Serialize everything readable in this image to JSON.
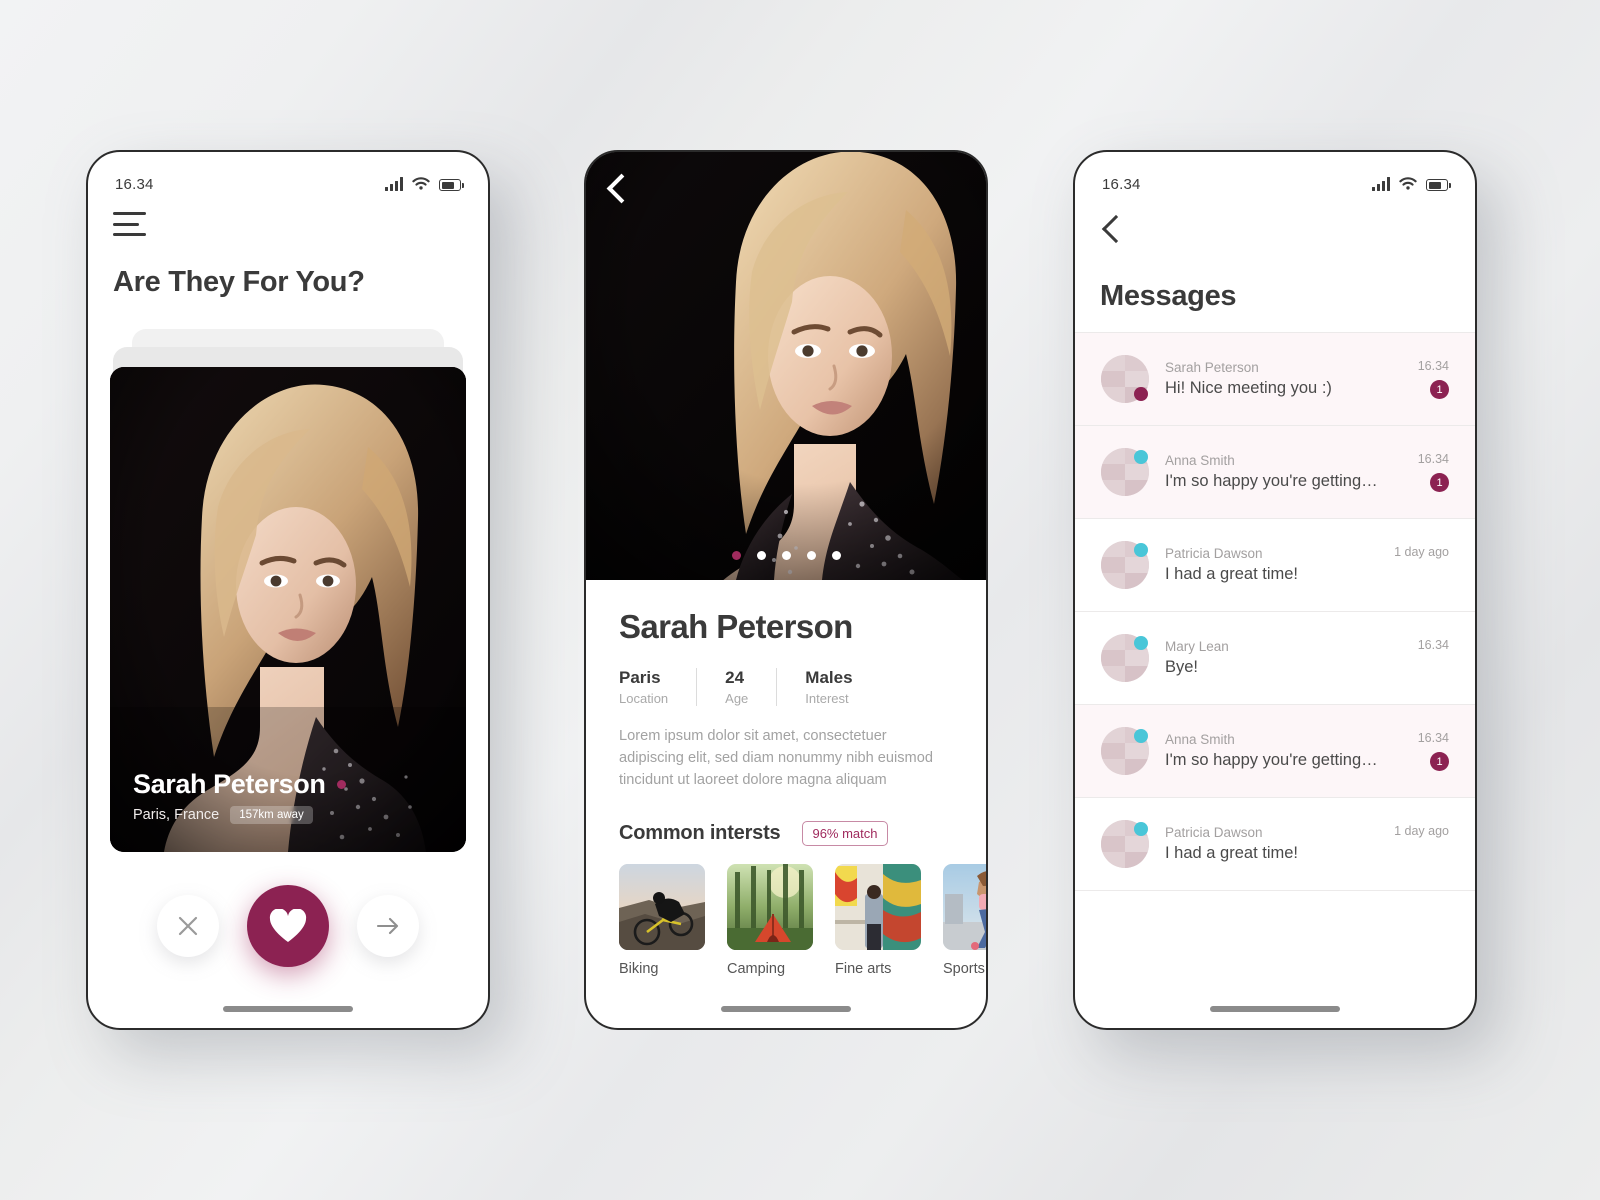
{
  "accent": "#8c2252",
  "accent_light": "#a02b5e",
  "cyan": "#49c6d8",
  "statusbar": {
    "time": "16.34",
    "signal_icon": "signal-bars-icon",
    "wifi_icon": "wifi-icon",
    "battery_icon": "battery-icon"
  },
  "screen1": {
    "menu_icon": "hamburger-menu-icon",
    "title": "Are They For You?",
    "card": {
      "name": "Sarah Peterson",
      "location": "Paris, France",
      "distance": "157km away",
      "online_dot": "online-status-dot"
    },
    "actions": {
      "reject_label": "close-icon",
      "like_label": "heart-icon",
      "next_label": "arrow-right-icon"
    }
  },
  "screen2": {
    "back_icon": "chevron-left-icon",
    "carousel": {
      "count": 5,
      "active_index": 0
    },
    "name": "Sarah Peterson",
    "stats": [
      {
        "value": "Paris",
        "label": "Location"
      },
      {
        "value": "24",
        "label": "Age"
      },
      {
        "value": "Males",
        "label": "Interest"
      }
    ],
    "bio": "Lorem ipsum dolor sit amet, consectetuer adipiscing elit, sed diam nonummy nibh euismod tincidunt ut laoreet dolore magna aliquam",
    "interests_title": "Common intersts",
    "match_badge": "96% match",
    "interests": [
      {
        "label": "Biking"
      },
      {
        "label": "Camping"
      },
      {
        "label": "Fine arts"
      },
      {
        "label": "Sports"
      }
    ]
  },
  "screen3": {
    "back_icon": "chevron-left-icon",
    "title": "Messages",
    "messages": [
      {
        "name": "Sarah Peterson",
        "text": "Hi! Nice meeting you :)",
        "time": "16.34",
        "count": "1",
        "unread": true,
        "badge": "pin"
      },
      {
        "name": "Anna Smith",
        "text": "I'm so happy you're getting…",
        "time": "16.34",
        "count": "1",
        "unread": true,
        "badge": "cyan"
      },
      {
        "name": "Patricia Dawson",
        "text": "I had a great time!",
        "time": "1 day ago",
        "count": "",
        "unread": false,
        "badge": "cyan"
      },
      {
        "name": "Mary Lean",
        "text": "Bye!",
        "time": "16.34",
        "count": "",
        "unread": false,
        "badge": "cyan"
      },
      {
        "name": "Anna Smith",
        "text": "I'm so happy you're getting…",
        "time": "16.34",
        "count": "1",
        "unread": true,
        "badge": "cyan"
      },
      {
        "name": "Patricia Dawson",
        "text": "I had a great time!",
        "time": "1 day ago",
        "count": "",
        "unread": false,
        "badge": "cyan"
      }
    ]
  }
}
